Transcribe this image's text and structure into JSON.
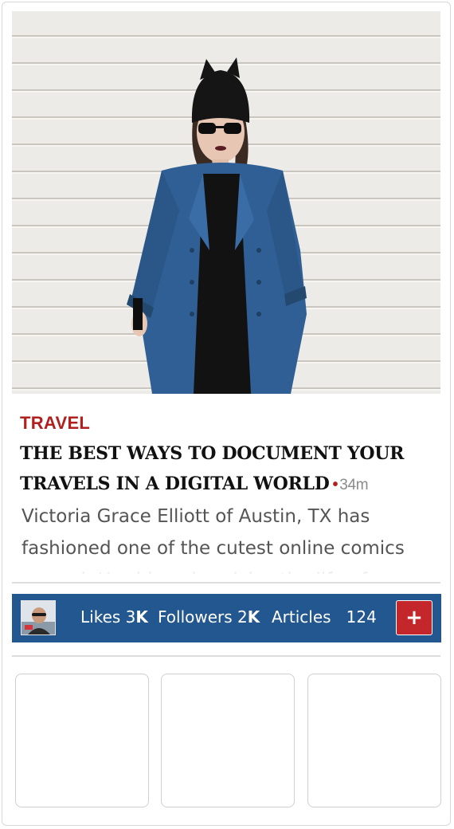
{
  "article": {
    "category": "TRAVEL",
    "headline": "THE BEST WAYS TO DOCUMENT YOUR TRAVELS IN A DIGITAL WORLD",
    "dot": "•",
    "time": "34m",
    "excerpt": "Victoria Grace Elliott of Austin, TX has fashioned one of the cutest online comics around. Her blog chronicles the life of"
  },
  "author_bar": {
    "likes_label": "Likes",
    "likes_count": "3",
    "likes_suffix": "K",
    "followers_label": "Followers",
    "followers_count": "2",
    "followers_suffix": "K",
    "articles_label": "Articles",
    "articles_count": "124",
    "add_symbol": "+"
  },
  "colors": {
    "accent_red": "#b0201f",
    "bar_blue": "#23578f",
    "button_red": "#c3272b"
  },
  "icons": [
    "author-avatar",
    "plus-icon"
  ]
}
